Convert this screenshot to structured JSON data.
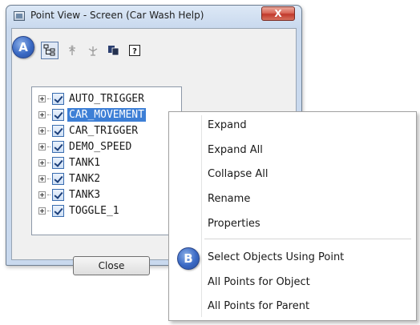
{
  "window": {
    "title": "Point View - Screen (Car Wash Help)",
    "close_glyph": "X",
    "close_button_label": "Close"
  },
  "toolbar": {
    "buttons": [
      {
        "icon": "tree-view-icon",
        "pressed": true
      },
      {
        "icon": "bookmark-point-icon"
      },
      {
        "icon": "bookmark-point-alt-icon"
      },
      {
        "icon": "copy-icon"
      },
      {
        "icon": "help-icon",
        "glyph": "?"
      }
    ]
  },
  "callouts": {
    "a": "A",
    "b": "B"
  },
  "tree": {
    "items": [
      {
        "label": "AUTO_TRIGGER",
        "checked": true,
        "selected": false
      },
      {
        "label": "CAR_MOVEMENT",
        "checked": true,
        "selected": true
      },
      {
        "label": "CAR_TRIGGER",
        "checked": true,
        "selected": false
      },
      {
        "label": "DEMO_SPEED",
        "checked": true,
        "selected": false
      },
      {
        "label": "TANK1",
        "checked": true,
        "selected": false
      },
      {
        "label": "TANK2",
        "checked": true,
        "selected": false
      },
      {
        "label": "TANK3",
        "checked": true,
        "selected": false
      },
      {
        "label": "TOGGLE_1",
        "checked": true,
        "selected": false
      }
    ]
  },
  "context_menu": {
    "items": [
      {
        "label": "Expand"
      },
      {
        "label": "Expand All"
      },
      {
        "label": "Collapse All"
      },
      {
        "label": "Rename"
      },
      {
        "label": "Properties"
      },
      {
        "label": "Select Objects Using Point"
      },
      {
        "label": "All Points for Object"
      },
      {
        "label": "All Points for Parent"
      }
    ]
  },
  "colors": {
    "selection": "#3d7fd6",
    "badge": "#3a69c4",
    "close_red": "#c1392b"
  }
}
